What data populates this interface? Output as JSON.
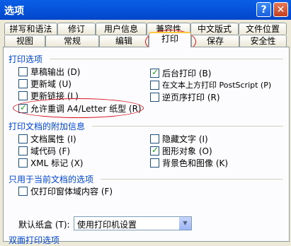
{
  "window": {
    "title": "选项",
    "help": "?",
    "close": "✕"
  },
  "tabs_row1": [
    "拼写和语法",
    "修订",
    "用户信息",
    "兼容性",
    "中文版式",
    "文件位置"
  ],
  "tabs_row2": [
    "视图",
    "常规",
    "编辑",
    "打印",
    "保存",
    "安全性"
  ],
  "print_options": {
    "heading": "打印选项",
    "items": [
      {
        "label": "草稿输出 (D)",
        "checked": false
      },
      {
        "label": "更新域 (U)",
        "checked": false
      },
      {
        "label": "更新链接 (L)",
        "checked": false
      },
      {
        "label": "允许重调 A4/Letter 纸型 (R)",
        "checked": true
      },
      {
        "label": "后台打印 (B)",
        "checked": true
      },
      {
        "label": "在文本上方打印 PostScript (P)",
        "checked": false
      },
      {
        "label": "逆页序打印 (R)",
        "checked": false
      }
    ]
  },
  "doc_info": {
    "heading": "打印文档的附加信息",
    "items": [
      {
        "label": "文档属性 (I)",
        "checked": false
      },
      {
        "label": "域代码 (F)",
        "checked": false
      },
      {
        "label": "XML 标记 (X)",
        "checked": false
      },
      {
        "label": "隐藏文字 (I)",
        "checked": false
      },
      {
        "label": "图形对象 (O)",
        "checked": true
      },
      {
        "label": "背景色和图像 (K)",
        "checked": false
      }
    ]
  },
  "current_doc": {
    "heading": "只用于当前文档的选项",
    "items": [
      {
        "label": "仅打印窗体域内容 (F)",
        "checked": false
      }
    ]
  },
  "tray": {
    "label": "默认纸盒 (T):",
    "value": "使用打印机设置"
  },
  "duplex": {
    "heading": "双面打印选项"
  }
}
